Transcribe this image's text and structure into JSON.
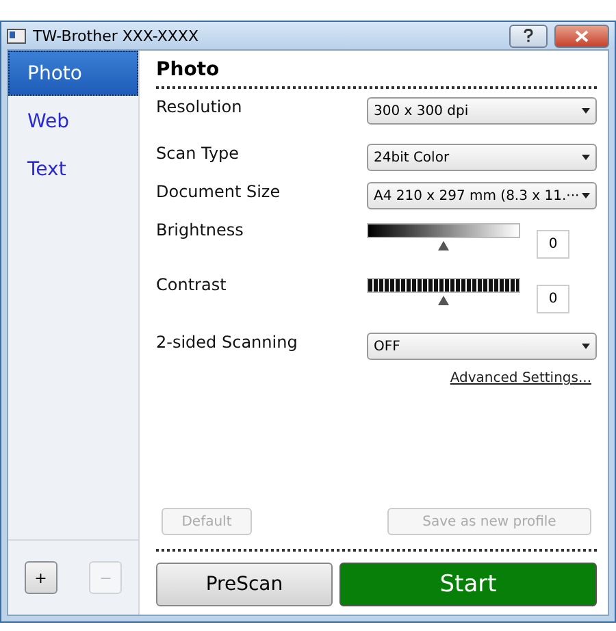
{
  "window": {
    "title": "TW-Brother XXX-XXXX"
  },
  "sidebar": {
    "items": [
      {
        "label": "Photo",
        "selected": true
      },
      {
        "label": "Web",
        "selected": false
      },
      {
        "label": "Text",
        "selected": false
      }
    ],
    "buttons": [
      {
        "label": "+",
        "disabled": false
      },
      {
        "label": "−",
        "disabled": true
      }
    ]
  },
  "panel": {
    "title": "Photo",
    "settings": [
      {
        "kind": "select",
        "label": "Resolution",
        "value": "300 x 300 dpi"
      },
      {
        "kind": "select",
        "label": "Scan Type",
        "value": "24bit Color"
      },
      {
        "kind": "select",
        "label": "Document Size",
        "value": "A4 210 x 297 mm (8.3 x 11.···"
      },
      {
        "kind": "gradient_slider",
        "label": "Brightness",
        "level": 0.5,
        "value": "0"
      },
      {
        "kind": "bar_slider",
        "label": "Contrast",
        "level": 0.5,
        "value": "0"
      },
      {
        "kind": "select",
        "label": "2-sided Scanning",
        "value": "OFF"
      }
    ],
    "advanced_link": "Advanced Settings...",
    "profile_buttons": [
      {
        "label": "Default",
        "disabled": true
      },
      {
        "label": "Save as new profile",
        "disabled": true
      }
    ],
    "prescan": "PreScan",
    "start": "Start"
  }
}
